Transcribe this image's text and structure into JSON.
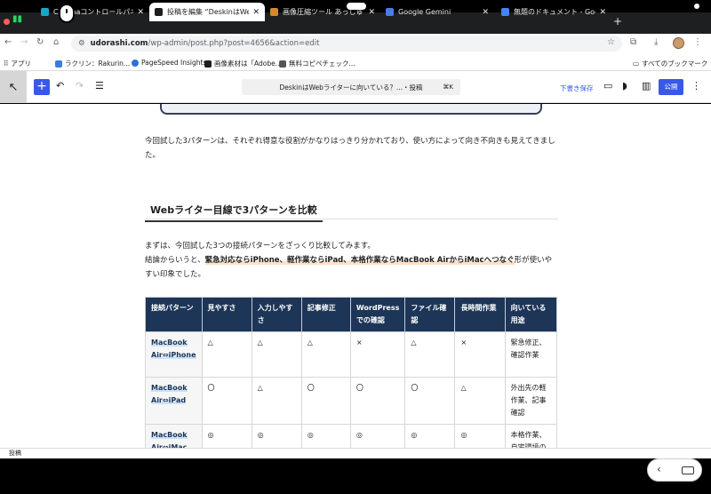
{
  "tabs": [
    {
      "title": "Conohaコントロールパネル",
      "fav_color": "#19a6c8"
    },
    {
      "title": "投稿を編集 “DeskinはWebライター",
      "fav_color": "#1e1e1e"
    },
    {
      "title": "画像圧縮ツール あっしゅくま | ",
      "fav_color": "#d28a2a"
    },
    {
      "title": "Google Gemini",
      "fav_color": "#4a7bea"
    },
    {
      "title": "無題のドキュメント - Google ド",
      "fav_color": "#4285f4"
    }
  ],
  "address": {
    "host": "udorashi.com",
    "path": "/wp-admin/post.php?post=4656&action=edit"
  },
  "bookmarks": {
    "apps": "アプリ",
    "items": [
      "ラクリン：Rakurin...",
      "PageSpeed Insights",
      "画像素材は「Adobe...",
      "無料コピペチェック..."
    ],
    "all": "すべてのブックマーク"
  },
  "editor": {
    "command_text": "DeskinはWebライターに向いている？...・投稿",
    "shortcut": "⌘K",
    "save_draft": "下書き保存",
    "publish": "公開"
  },
  "content": {
    "intro": "今回試した3パターンは、それぞれ得意な役割がかなりはっきり分かれており、使い方によって向き不向きも見えてきました。",
    "heading": "Webライター目線で3パターンを比較",
    "p1": "まずは、今回試した3つの接続パターンをざっくり比較してみます。",
    "p2_pre": "結論からいうと、",
    "p2_hl": "緊急対応ならiPhone、軽作業ならiPad、本格作業ならMacBook AirからiMacへつなぐ",
    "p2_post": "形が使いやすい印象でした。"
  },
  "table": {
    "headers": [
      "接続パターン",
      "見やすさ",
      "入力しやすさ",
      "記事修正",
      "WordPressでの確認",
      "ファイル確認",
      "長時間作業",
      "向いている用途"
    ],
    "rows": [
      [
        "MacBook Air⇔iPhone",
        "△",
        "△",
        "△",
        "×",
        "△",
        "×",
        "緊急修正、確認作業"
      ],
      [
        "MacBook Air⇔iPad",
        "〇",
        "△",
        "〇",
        "〇",
        "〇",
        "△",
        "外出先の軽作業、記事確認"
      ],
      [
        "MacBook Air⇔iMac",
        "◎",
        "◎",
        "◎",
        "◎",
        "◎",
        "◎",
        "本格作業、自宅環境の"
      ]
    ]
  },
  "status": "投稿"
}
